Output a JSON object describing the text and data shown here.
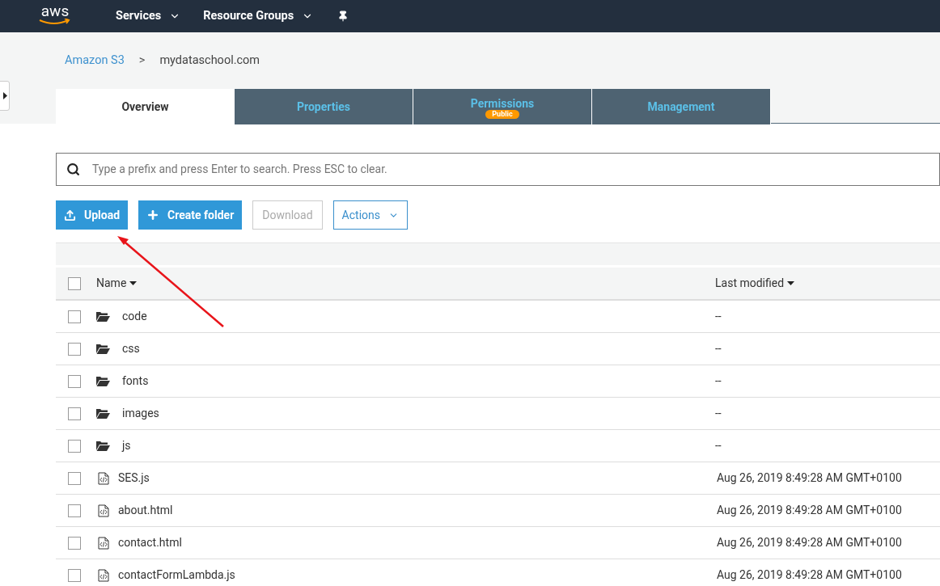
{
  "top_bar": {
    "logo": "aws",
    "menus": [
      {
        "label": "Services"
      },
      {
        "label": "Resource Groups"
      }
    ]
  },
  "breadcrumb": {
    "root": "Amazon S3",
    "separator": ">",
    "current": "mydataschool.com"
  },
  "tabs": [
    {
      "label": "Overview",
      "selected": true
    },
    {
      "label": "Properties",
      "selected": false
    },
    {
      "label": "Permissions",
      "selected": false,
      "badge": "Public"
    },
    {
      "label": "Management",
      "selected": false
    }
  ],
  "search": {
    "placeholder": "Type a prefix and press Enter to search. Press ESC to clear."
  },
  "toolbar": [
    {
      "kind": "upload",
      "label": "Upload",
      "disabled": false
    },
    {
      "kind": "create",
      "label": "Create folder",
      "disabled": false
    },
    {
      "kind": "plain",
      "label": "Download",
      "disabled": true
    },
    {
      "kind": "menu",
      "label": "Actions",
      "disabled": false
    }
  ],
  "table": {
    "columns": [
      "Name",
      "Last modified"
    ],
    "select_all": {
      "checked": false
    },
    "rows": [
      {
        "kind": "folder",
        "name": "code",
        "modified": "--",
        "checked": false
      },
      {
        "kind": "folder",
        "name": "css",
        "modified": "--",
        "checked": false
      },
      {
        "kind": "folder",
        "name": "fonts",
        "modified": "--",
        "checked": false
      },
      {
        "kind": "folder",
        "name": "images",
        "modified": "--",
        "checked": false
      },
      {
        "kind": "folder",
        "name": "js",
        "modified": "--",
        "checked": false
      },
      {
        "kind": "file",
        "name": "SES.js",
        "modified": "Aug 26, 2019 8:49:28 AM GMT+0100",
        "checked": false
      },
      {
        "kind": "file",
        "name": "about.html",
        "modified": "Aug 26, 2019 8:49:28 AM GMT+0100",
        "checked": false
      },
      {
        "kind": "file",
        "name": "contact.html",
        "modified": "Aug 26, 2019 8:49:28 AM GMT+0100",
        "checked": false
      },
      {
        "kind": "file",
        "name": "contactFormLambda.js",
        "modified": "Aug 26, 2019 8:49:28 AM GMT+0100",
        "checked": false
      }
    ]
  }
}
